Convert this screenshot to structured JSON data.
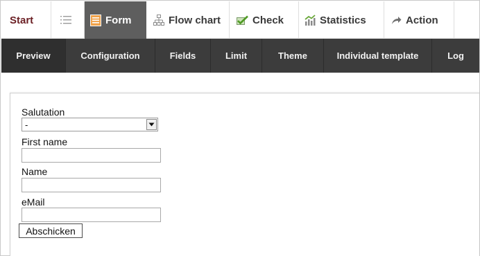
{
  "top_tabs": [
    {
      "label": "Start",
      "icon": "none"
    },
    {
      "label": "",
      "icon": "list-icon"
    },
    {
      "label": "Form",
      "icon": "form-icon"
    },
    {
      "label": "Flow chart",
      "icon": "flowchart-icon"
    },
    {
      "label": "Check",
      "icon": "check-icon"
    },
    {
      "label": "Statistics",
      "icon": "statistics-icon"
    },
    {
      "label": "Action",
      "icon": "arrow-right-icon"
    }
  ],
  "sub_tabs": [
    "Preview",
    "Configuration",
    "Fields",
    "Limit",
    "Theme",
    "Individual template",
    "Log"
  ],
  "active_sub_tab": "Preview",
  "form": {
    "salutation_label": "Salutation",
    "salutation_value": "-",
    "first_name_label": "First name",
    "first_name_value": "",
    "name_label": "Name",
    "name_value": "",
    "email_label": "eMail",
    "email_value": "",
    "submit_label": "Abschicken"
  },
  "colors": {
    "start_text": "#6b1f24",
    "active_top_tab_bg": "#5e5e5e",
    "subnav_bg": "#3c3c3c",
    "form_icon": "#f0a24a",
    "check_icon": "#5aa02c",
    "statistics_icon": "#6aa83a"
  }
}
